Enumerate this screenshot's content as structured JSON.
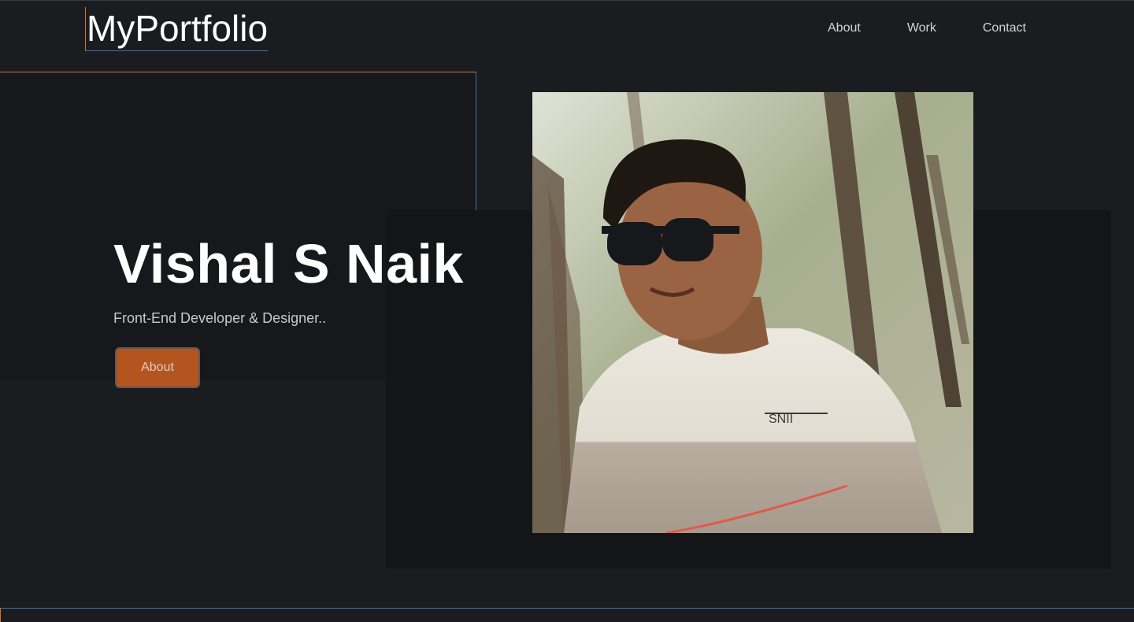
{
  "header": {
    "logo": "MyPortfolio",
    "nav": [
      "About",
      "Work",
      "Contact"
    ]
  },
  "hero": {
    "name": "Vishal S Naik",
    "subtitle": "Front-End Developer & Designer..",
    "button_label": "About"
  },
  "colors": {
    "background": "#1b1c20",
    "accent_orange": "#b4541f",
    "border_orange": "#d2752c",
    "border_blue": "#3f6fb5"
  }
}
